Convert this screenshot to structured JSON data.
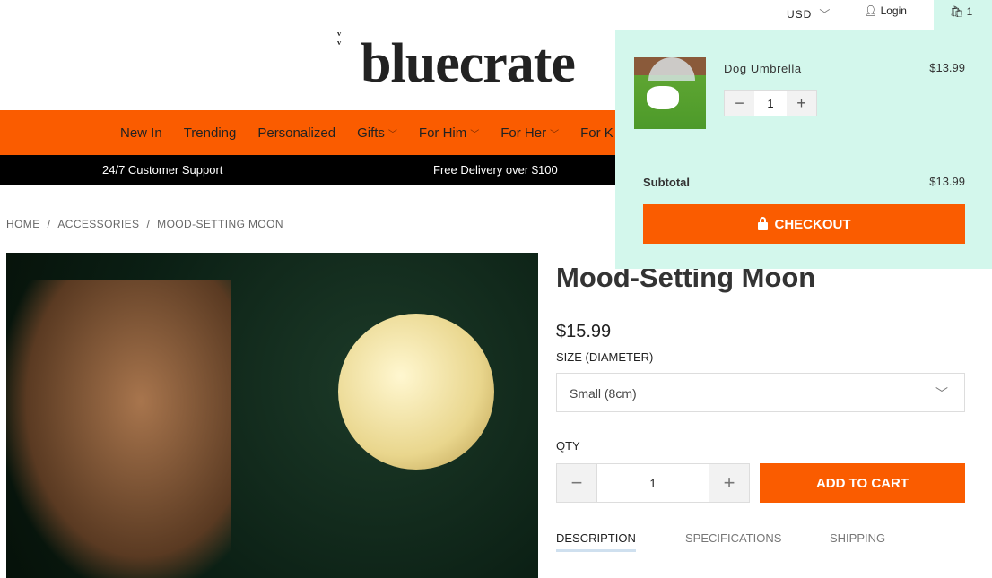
{
  "header": {
    "currency": "USD",
    "login": "Login",
    "cart_count": "1",
    "logo": "bluecrate"
  },
  "nav": {
    "items": [
      {
        "label": "New In"
      },
      {
        "label": "Trending"
      },
      {
        "label": "Personalized"
      },
      {
        "label": "Gifts"
      },
      {
        "label": "For Him"
      },
      {
        "label": "For Her"
      },
      {
        "label": "For K"
      }
    ]
  },
  "promo": {
    "support": "24/7 Customer Support",
    "delivery": "Free Delivery over $100"
  },
  "breadcrumb": [
    "HOME",
    "ACCESSORIES",
    "MOOD-SETTING MOON"
  ],
  "product": {
    "title": "Mood-Setting Moon",
    "price": "$15.99",
    "size_label": "SIZE (DIAMETER)",
    "size_value": "Small (8cm)",
    "qty_label": "QTY",
    "qty": "1",
    "add_to_cart": "ADD TO CART",
    "tabs": [
      "DESCRIPTION",
      "SPECIFICATIONS",
      "SHIPPING"
    ]
  },
  "cart": {
    "item_name": "Dog Umbrella",
    "item_price": "$13.99",
    "item_qty": "1",
    "subtotal_label": "Subtotal",
    "subtotal": "$13.99",
    "checkout": "CHECKOUT"
  },
  "colors": {
    "accent": "#fa5c00",
    "cart_bg": "#d3f7ec"
  }
}
